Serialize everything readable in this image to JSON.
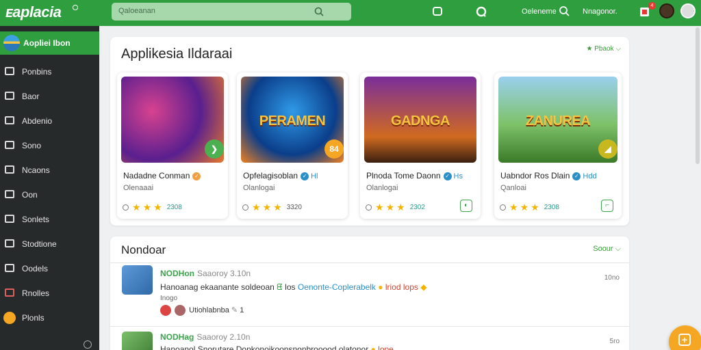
{
  "topbar": {
    "logo": "ᴇaplacia",
    "search_placeholder": "Qaloeanan",
    "right_label": "Oeleneme",
    "user_label": "Nnagonor.",
    "notification_count": "4",
    "colors": {
      "bar": "#2e9e3e",
      "search": "#a6d8ac"
    }
  },
  "sidebar": {
    "header": "Aopliei Ibon",
    "items": [
      {
        "label": "Ponbins",
        "icon": "home-icon"
      },
      {
        "label": "Baor",
        "icon": "box-icon"
      },
      {
        "label": "Abdenio",
        "icon": "tag-icon"
      },
      {
        "label": "Sono",
        "icon": "check-icon"
      },
      {
        "label": "Ncaons",
        "icon": "calendar-icon"
      },
      {
        "label": "Oon",
        "icon": "checkbox-icon"
      },
      {
        "label": "Sonlets",
        "icon": "check-square-icon"
      },
      {
        "label": "Stodtione",
        "icon": "wrench-icon"
      },
      {
        "label": "Oodels",
        "icon": "lock-icon"
      },
      {
        "label": "Rnolles",
        "icon": "grid-icon"
      },
      {
        "label": "Plonls",
        "icon": "coin-icon"
      }
    ]
  },
  "featured": {
    "title": "Applikesia Ildaraai",
    "control": "Pbaok",
    "apps": [
      {
        "image_text": "",
        "name": "Nadadne Conman",
        "tag": "",
        "subtitle": "Olenaaai",
        "rating_count": "2308",
        "badge": "❯",
        "action": "",
        "badge_color": "#4caf50",
        "verified_color": "#f0a040"
      },
      {
        "image_text": "PERAMEN",
        "name": "Opfelagisoblan",
        "tag": "Hl",
        "subtitle": "Olanlogai",
        "rating_count": "3320",
        "badge": "84",
        "action": "",
        "badge_color": "#f5a623",
        "verified_color": "#2a8fc7"
      },
      {
        "image_text": "GADNGA",
        "name": "Plnoda Tome Daonn",
        "tag": "Hs",
        "subtitle": "Olanlogai",
        "rating_count": "2302",
        "badge": "",
        "action": "◐",
        "badge_color": "",
        "verified_color": "#2a8fc7"
      },
      {
        "image_text": "ZANUREA",
        "name": "Uabndor Ros Dlain",
        "tag": "Hdd",
        "subtitle": "Qanloai",
        "rating_count": "2308",
        "badge": "◢",
        "action": "⌐",
        "badge_color": "#c8b820",
        "verified_color": "#2a8fc7"
      }
    ]
  },
  "feed": {
    "title": "Nondoar",
    "control": "Soour",
    "posts": [
      {
        "user": "NODHon",
        "meta": "Saaoroy 3.10n",
        "text_a": "Hanoanag ekaanante soldeoan",
        "text_icon": "ᘀ",
        "text_b": "los",
        "link": "Oenonte-Coplerabelk",
        "emoji": "●",
        "red": "lriod lops",
        "emoji2": "◆",
        "small": "Inogo",
        "reactions": "Utiohlabnba",
        "reaction_count": "1",
        "time": "10no"
      },
      {
        "user": "NODHag",
        "meta": "Saaoroy 2.10n",
        "text_a": "Hanoanol Snorutare Donkonoikoonsnonbrooood olatonor",
        "emoji": "●",
        "red": "lope",
        "time": "5ro"
      }
    ]
  }
}
